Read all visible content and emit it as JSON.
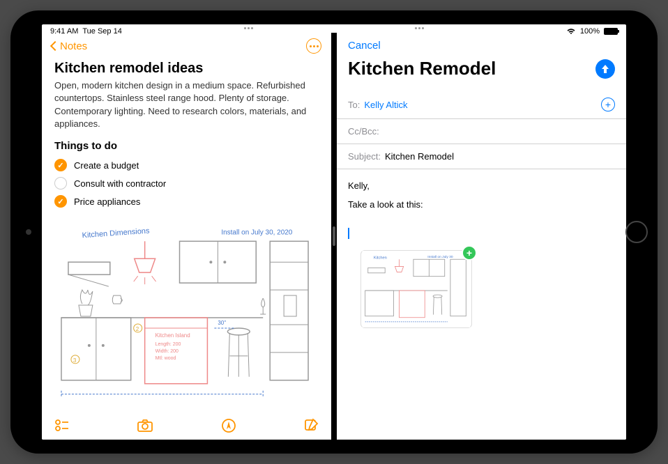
{
  "status": {
    "time": "9:41 AM",
    "date": "Tue Sep 14",
    "battery": "100%"
  },
  "notes": {
    "back_label": "Notes",
    "title": "Kitchen remodel ideas",
    "body": "Open, modern kitchen design in a medium space. Refurbished countertops. Stainless steel range hood. Plenty of storage. Contemporary lighting. Need to research colors, materials, and appliances.",
    "todo_heading": "Things to do",
    "todos": [
      {
        "label": "Create a budget",
        "checked": true
      },
      {
        "label": "Consult with contractor",
        "checked": false
      },
      {
        "label": "Price appliances",
        "checked": true
      }
    ],
    "sketch_annotations": {
      "top_left": "Kitchen Dimensions",
      "top_right": "Install on July 30, 2020"
    }
  },
  "mail": {
    "cancel_label": "Cancel",
    "compose_title": "Kitchen Remodel",
    "to_label": "To:",
    "to_value": "Kelly Altick",
    "cc_label": "Cc/Bcc:",
    "subject_label": "Subject:",
    "subject_value": "Kitchen Remodel",
    "body_line1": "Kelly,",
    "body_line2": "Take a look at this:"
  }
}
